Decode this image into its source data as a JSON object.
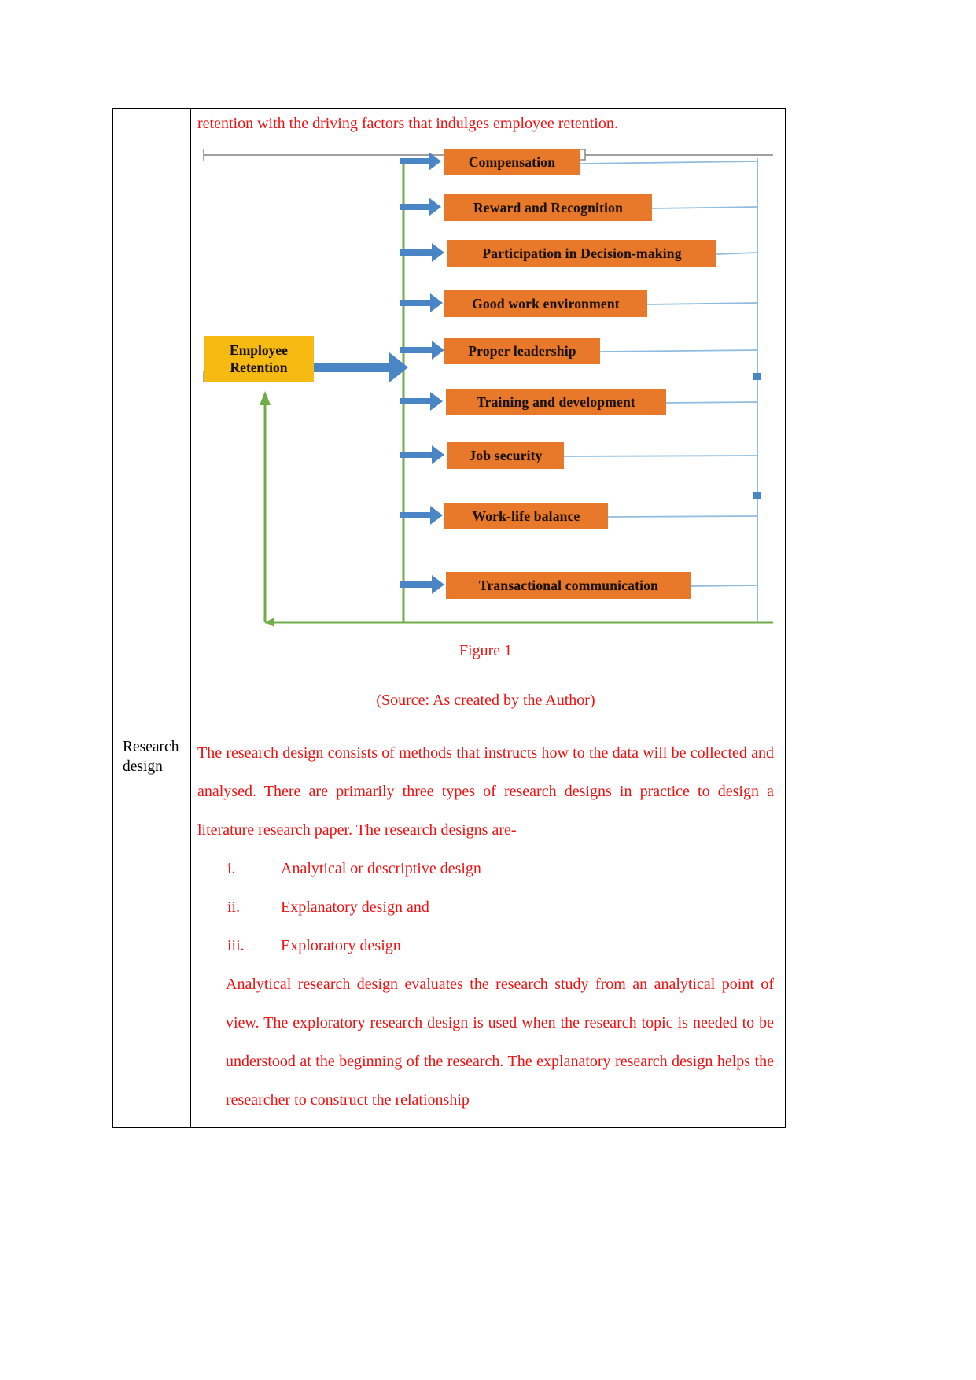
{
  "document": {
    "intro_text": "retention with the driving factors that indulges employee retention.",
    "figure": {
      "caption": "Figure 1",
      "source": "(Source: As created by the Author)",
      "center_node": {
        "line1": "Employee",
        "line2": "Retention"
      },
      "factor_nodes": [
        "Compensation",
        "Reward and Recognition",
        "Participation in Decision-making",
        "Good work environment",
        "Proper leadership",
        "Training and development",
        "Job security",
        "Work-life balance",
        "Transactional communication"
      ],
      "colors": {
        "node_fill": "#e8782a",
        "center_fill": "#f6bb12",
        "arrow_blue": "#4a86c5",
        "connector_green": "#70ad47",
        "thin_blue": "#8fbcdf",
        "ruler_grey": "#808080"
      }
    },
    "rows": [
      {
        "label": "Research design",
        "label_line1": "Research",
        "label_line2": "design",
        "paragraphs": [
          "The research design consists of methods that instructs how to the data will be collected and analysed. There are primarily three types of research designs in practice to design a literature research paper. The research designs are-"
        ],
        "list": [
          {
            "num": "i.",
            "text": "Analytical or descriptive design"
          },
          {
            "num": "ii.",
            "text": "Explanatory design and"
          },
          {
            "num": "iii.",
            "text": "Exploratory design"
          }
        ],
        "closing_paragraph": "Analytical research design evaluates the research study from an analytical point of view. The exploratory research design is used when the research topic is needed to be understood at the beginning of the research. The explanatory research design helps the researcher to construct the relationship"
      }
    ]
  }
}
